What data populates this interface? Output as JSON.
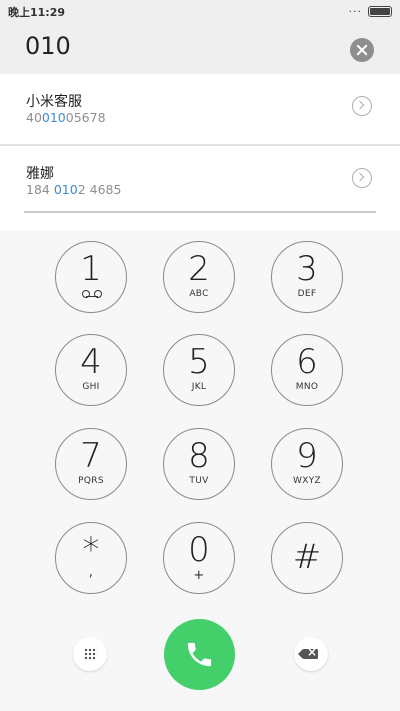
{
  "status_bar": {
    "time": "晚上11:29",
    "dots": "···"
  },
  "dialer": {
    "number": "010"
  },
  "results": [
    {
      "name": "小米客服",
      "number_pre": "40",
      "number_match": "010",
      "number_post": "05678"
    },
    {
      "name": "雅娜",
      "number_pre": "184 ",
      "number_match": "010",
      "number_post": "2 4685"
    }
  ],
  "keys": [
    {
      "digit": "1",
      "letters": ""
    },
    {
      "digit": "2",
      "letters": "ABC"
    },
    {
      "digit": "3",
      "letters": "DEF"
    },
    {
      "digit": "4",
      "letters": "GHI"
    },
    {
      "digit": "5",
      "letters": "JKL"
    },
    {
      "digit": "6",
      "letters": "MNO"
    },
    {
      "digit": "7",
      "letters": "PQRS"
    },
    {
      "digit": "8",
      "letters": "TUV"
    },
    {
      "digit": "9",
      "letters": "WXYZ"
    },
    {
      "digit": "*",
      "letters": ","
    },
    {
      "digit": "0",
      "letters": "+"
    },
    {
      "digit": "#",
      "letters": ""
    }
  ],
  "icons": {
    "voicemail": "voicemail-icon",
    "clear": "clear-icon",
    "info": "chevron-right-icon",
    "keypad": "keypad-grid-icon",
    "backspace": "backspace-icon",
    "call": "phone-icon"
  },
  "colors": {
    "call_green": "#45cf6a",
    "match_blue": "#3a8bd6"
  }
}
